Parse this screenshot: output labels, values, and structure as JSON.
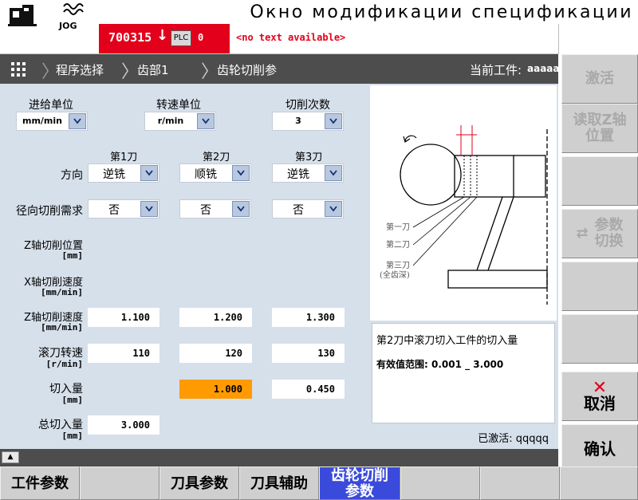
{
  "caption": "Окно модификации спецификации",
  "header": {
    "mode": "JOG",
    "alarm_number": "700315",
    "plc_label": "PLC",
    "alarm_zero": "0",
    "alarm_text": "<no text available>"
  },
  "breadcrumb": {
    "items": [
      "程序选择",
      "齿部1",
      "齿轮切削参"
    ],
    "current_workpiece_label": "当前工件:",
    "current_workpiece_value": "aaaaa"
  },
  "softkeys_right": {
    "activate": "激活",
    "read_z_pos": [
      "读取Z轴",
      "位置"
    ],
    "param_switch": [
      "参数",
      "切换"
    ],
    "cancel": "取消",
    "confirm": "确认"
  },
  "softkeys_bottom": {
    "workpiece_params": "工件参数",
    "tool_params": "刀具参数",
    "tool_aux": "刀具辅助",
    "gear_cut_params": [
      "齿轮切削",
      "参数"
    ]
  },
  "form": {
    "feed_unit_label": "进给单位",
    "feed_unit_value": "mm/min",
    "speed_unit_label": "转速单位",
    "speed_unit_value": "r/min",
    "cut_count_label": "切削次数",
    "cut_count_value": "3",
    "cut_headers": [
      "第1刀",
      "第2刀",
      "第3刀"
    ],
    "direction_label": "方向",
    "direction_values": [
      "逆铣",
      "顺铣",
      "逆铣"
    ],
    "radial_label": "径向切削需求",
    "radial_values": [
      "否",
      "否",
      "否"
    ],
    "z_pos_label": "Z轴切削位置",
    "z_pos_unit": "[mm]",
    "x_speed_label": "X轴切削速度",
    "x_speed_unit": "[mm/min]",
    "z_speed_label": "Z轴切削速度",
    "z_speed_unit": "[mm/min]",
    "z_speed_values": [
      "1.100",
      "1.200",
      "1.300"
    ],
    "hob_speed_label": "滚刀转速",
    "hob_speed_unit": "[r/min]",
    "hob_speed_values": [
      "110",
      "120",
      "130"
    ],
    "depth_label": "切入量",
    "depth_unit": "[mm]",
    "depth_values": [
      "",
      "1.000",
      "0.450"
    ],
    "total_depth_label": "总切入量",
    "total_depth_unit": "[mm]",
    "total_depth_value": "3.000"
  },
  "diagram": {
    "labels": [
      "第一刀",
      "第二刀",
      "第三刀",
      "(全齿深)"
    ]
  },
  "info": {
    "title": "第2刀中滚刀切入工件的切入量",
    "range": "有效值范围: 0.001 _ 3.000",
    "status": "已激活: qqqqq"
  }
}
